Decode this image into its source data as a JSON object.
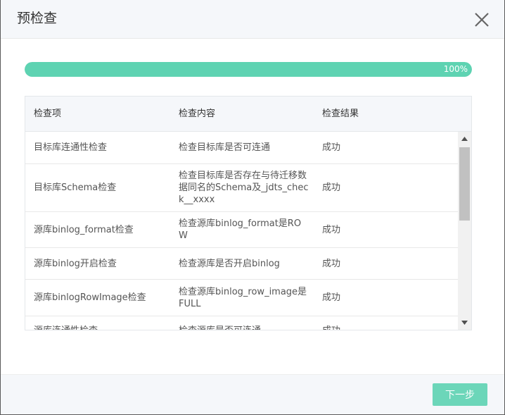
{
  "dialog": {
    "title": "预检查"
  },
  "progress": {
    "percent": 100,
    "label": "100%"
  },
  "table": {
    "columns": [
      "检查项",
      "检查内容",
      "检查结果"
    ],
    "rows": [
      {
        "item": "目标库连通性检查",
        "content": "检查目标库是否可连通",
        "result": "成功"
      },
      {
        "item": "目标库Schema检查",
        "content": "检查目标库是否存在与待迁移数据同名的Schema及_jdts_check__xxxx",
        "result": "成功"
      },
      {
        "item": "源库binlog_format检查",
        "content": "检查源库binlog_format是ROW",
        "result": "成功"
      },
      {
        "item": "源库binlog开启检查",
        "content": "检查源库是否开启binlog",
        "result": "成功"
      },
      {
        "item": "源库binlogRowImage检查",
        "content": "检查源库binlog_row_image是FULL",
        "result": "成功"
      },
      {
        "item": "源库连通性检查",
        "content": "检查源库是否可连通",
        "result": "成功"
      }
    ]
  },
  "footer": {
    "next_label": "下一步"
  },
  "colors": {
    "accent": "#5ed3b2"
  }
}
